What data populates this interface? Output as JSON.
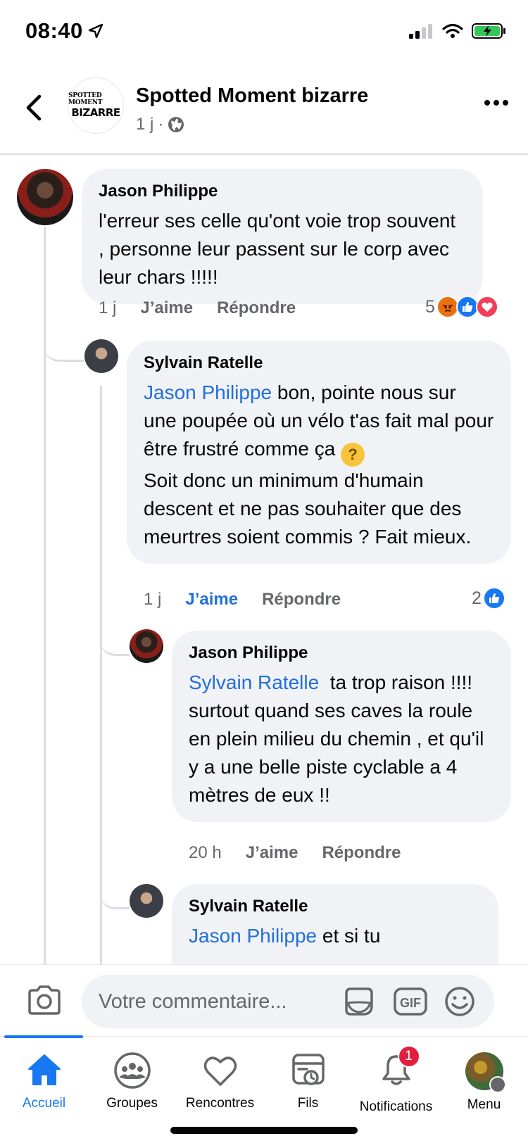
{
  "status_bar": {
    "time": "08:40"
  },
  "header": {
    "page_name": "Spotted Moment bizarre",
    "logo_top": "SPOTTED MOMENT",
    "logo_bottom": "BIZARRE",
    "post_time": "1 j",
    "separator": "·"
  },
  "comments": [
    {
      "author": "Jason Philippe",
      "text": "l'erreur ses celle qu'ont voie trop souvent , personne leur passent sur le corp avec leur chars !!!!!",
      "time": "1 j",
      "like_label": "J’aime",
      "reply_label": "Répondre",
      "reaction_count": "5",
      "reactions": [
        "angry",
        "like",
        "love"
      ]
    },
    {
      "author": "Sylvain Ratelle",
      "mention": "Jason Philippe",
      "text_line1": " bon, pointe nous sur une poupée où un vélo t'as fait mal pour être frustré comme ça",
      "emoji": "thinking",
      "text_line2": "Soit donc un minimum d'humain descent et ne pas souhaiter que des meurtres soient commis ? Fait mieux.",
      "time": "1 j",
      "like_label": "J’aime",
      "like_active": true,
      "reply_label": "Répondre",
      "reaction_count": "2",
      "reactions": [
        "like"
      ]
    },
    {
      "author": "Jason Philippe",
      "mention": "Sylvain Ratelle",
      "text": "  ta trop raison !!!! surtout quand ses caves la roule en plein milieu du chemin , et qu'il y a une belle piste cyclable a 4 mètres de eux !!",
      "time": "20 h",
      "like_label": "J’aime",
      "reply_label": "Répondre"
    },
    {
      "author": "Sylvain Ratelle",
      "mention": "Jason Philippe",
      "text": " et si tu"
    }
  ],
  "composer": {
    "placeholder": "Votre commentaire...",
    "gif_label": "GIF"
  },
  "tabbar": {
    "tabs": [
      {
        "label": "Accueil",
        "active": true
      },
      {
        "label": "Groupes"
      },
      {
        "label": "Rencontres"
      },
      {
        "label": "Fils"
      },
      {
        "label": "Notifications",
        "badge": "1"
      },
      {
        "label": "Menu"
      }
    ]
  },
  "colors": {
    "accent": "#1877f2",
    "mention": "#216fdb",
    "bubble": "#f0f2f5",
    "secondary_text": "#65676b",
    "badge": "#e41e3f"
  }
}
